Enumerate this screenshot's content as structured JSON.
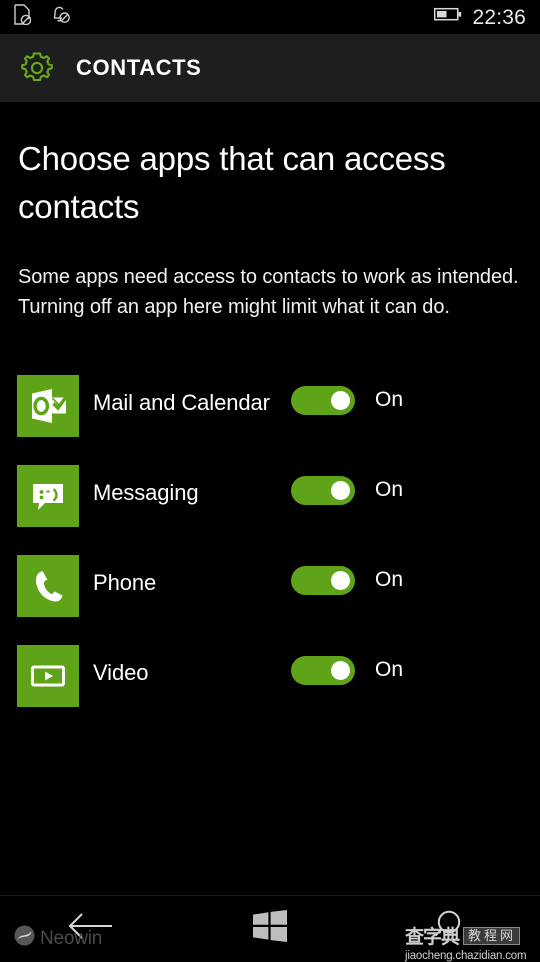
{
  "status_bar": {
    "icons": [
      "no-sim-icon",
      "notifications-off-icon"
    ],
    "battery_level_percent": 50,
    "time": "22:36"
  },
  "header": {
    "icon": "settings-gear-icon",
    "title": "CONTACTS"
  },
  "main": {
    "page_title": "Choose apps that can access contacts",
    "description": "Some apps need access to contacts to work as intended. Turning off an app here might limit what it can do.",
    "apps": [
      {
        "name": "Mail and Calendar",
        "icon": "outlook-mail-calendar-icon",
        "toggle_state": "On",
        "toggle_on": true
      },
      {
        "name": "Messaging",
        "icon": "messaging-speech-bubble-icon",
        "toggle_state": "On",
        "toggle_on": true
      },
      {
        "name": "Phone",
        "icon": "phone-handset-icon",
        "toggle_state": "On",
        "toggle_on": true
      },
      {
        "name": "Video",
        "icon": "video-play-icon",
        "toggle_state": "On",
        "toggle_on": true
      }
    ]
  },
  "nav_bar": {
    "back": "back-arrow-icon",
    "start": "windows-start-icon",
    "search": "search-icon"
  },
  "watermarks": {
    "neowin": "Neowin",
    "cn_main": "查字典",
    "cn_box": "教程网",
    "cn_url": "jiaocheng.chazidian.com"
  },
  "colors": {
    "accent_green": "#5fa318",
    "header_bg": "#1e1e1e",
    "page_bg": "#000000"
  }
}
